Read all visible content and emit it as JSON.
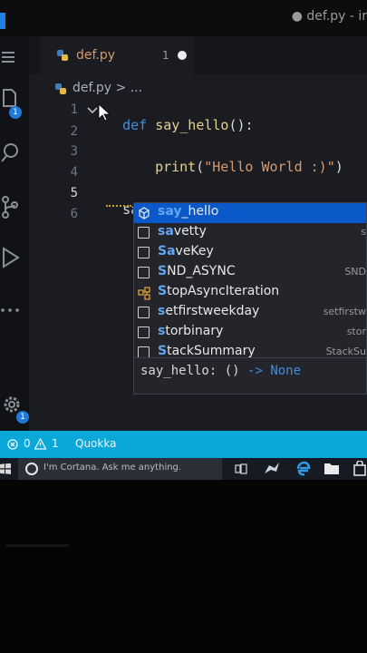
{
  "window": {
    "title": "● def.py - ir"
  },
  "tab": {
    "filename": "def.py",
    "problems": "1"
  },
  "breadcrumb": {
    "file": "def.py",
    "sep": ">",
    "more": "..."
  },
  "activity_bar": {
    "explorer_badge": "1",
    "settings_badge": "1"
  },
  "gutter": [
    "1",
    "2",
    "3",
    "4",
    "5",
    "6"
  ],
  "code": {
    "line1_kw": "def",
    "line1_fn": "say_hello",
    "line1_rest": "():",
    "line3_fn": "print",
    "line3_open": "(",
    "line3_str": "\"Hello World :)\"",
    "line3_close": ")",
    "line5_text": "say"
  },
  "suggestions": [
    {
      "pre": "",
      "match": "say",
      "post": "_hello",
      "icon": "cube-icon",
      "detail": "",
      "selected": true
    },
    {
      "pre": "",
      "match": "sa",
      "post": "vetty",
      "icon": "square-icon",
      "detail": "s",
      "selected": false
    },
    {
      "pre": "",
      "match": "Sa",
      "post": "veKey",
      "icon": "square-icon",
      "detail": "",
      "selected": false
    },
    {
      "pre": "",
      "match": "S",
      "post": "ND_ASYNC",
      "icon": "square-icon",
      "detail": "SND",
      "selected": false
    },
    {
      "pre": "",
      "match": "S",
      "post": "topAsyncIteration",
      "icon": "class-icon",
      "detail": "",
      "selected": false
    },
    {
      "pre": "",
      "match": "s",
      "post": "etfirstweekday",
      "icon": "square-icon",
      "detail": "setfirstw",
      "selected": false
    },
    {
      "pre": "",
      "match": "s",
      "post": "torbinary",
      "icon": "square-icon",
      "detail": "stor",
      "selected": false
    },
    {
      "pre": "",
      "match": "S",
      "post": "tackSummary",
      "icon": "square-icon",
      "detail": "StackSu",
      "selected": false
    }
  ],
  "suggest_doc": {
    "name": "say_hello",
    "colon": ":",
    "params": "()",
    "arrow": "->",
    "ret": "None"
  },
  "status": {
    "errors": "0",
    "warnings": "1",
    "extension": "Quokka"
  },
  "taskbar": {
    "cortana_placeholder": "I'm Cortana. Ask me anything."
  },
  "colors": {
    "accent": "#0b58c9",
    "statusbar": "#0aa7d9",
    "keyword": "#3f8fe0",
    "string": "#d79a6e",
    "function": "#e6d28c"
  }
}
